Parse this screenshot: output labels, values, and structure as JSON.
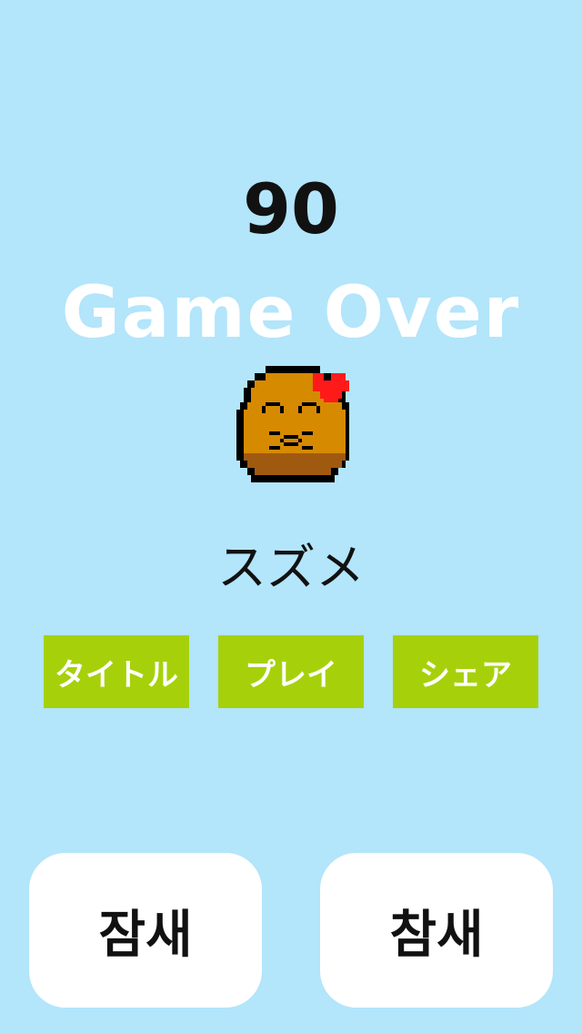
{
  "score": "90",
  "game_over_label": "Game Over",
  "character": {
    "name": "スズメ",
    "icon": "potato-bird-icon",
    "colors": {
      "body": "#d68a00",
      "shade": "#a05a10",
      "outline": "#000000",
      "bow": "#ff1a1a"
    }
  },
  "menu": {
    "title_label": "タイトル",
    "play_label": "プレイ",
    "share_label": "シェア"
  },
  "bottom": {
    "left_label": "잠새",
    "right_label": "참새"
  },
  "colors": {
    "background": "#b3e5fb",
    "button_green": "#a6d10a",
    "button_white": "#ffffff"
  }
}
